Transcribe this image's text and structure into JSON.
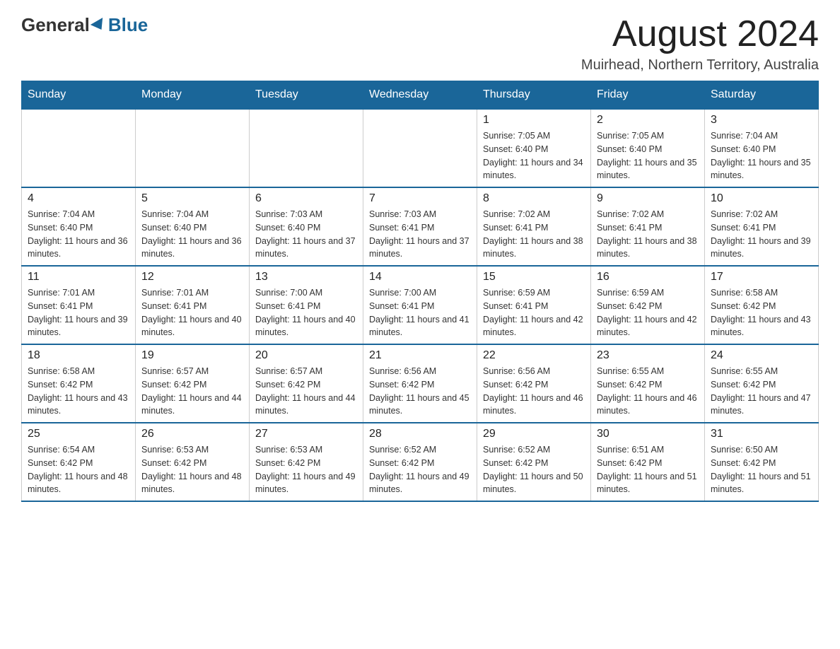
{
  "header": {
    "logo": {
      "general": "General",
      "blue": "Blue"
    },
    "title": "August 2024",
    "location": "Muirhead, Northern Territory, Australia"
  },
  "days_of_week": [
    "Sunday",
    "Monday",
    "Tuesday",
    "Wednesday",
    "Thursday",
    "Friday",
    "Saturday"
  ],
  "weeks": [
    [
      {
        "day": "",
        "info": ""
      },
      {
        "day": "",
        "info": ""
      },
      {
        "day": "",
        "info": ""
      },
      {
        "day": "",
        "info": ""
      },
      {
        "day": "1",
        "info": "Sunrise: 7:05 AM\nSunset: 6:40 PM\nDaylight: 11 hours and 34 minutes."
      },
      {
        "day": "2",
        "info": "Sunrise: 7:05 AM\nSunset: 6:40 PM\nDaylight: 11 hours and 35 minutes."
      },
      {
        "day": "3",
        "info": "Sunrise: 7:04 AM\nSunset: 6:40 PM\nDaylight: 11 hours and 35 minutes."
      }
    ],
    [
      {
        "day": "4",
        "info": "Sunrise: 7:04 AM\nSunset: 6:40 PM\nDaylight: 11 hours and 36 minutes."
      },
      {
        "day": "5",
        "info": "Sunrise: 7:04 AM\nSunset: 6:40 PM\nDaylight: 11 hours and 36 minutes."
      },
      {
        "day": "6",
        "info": "Sunrise: 7:03 AM\nSunset: 6:40 PM\nDaylight: 11 hours and 37 minutes."
      },
      {
        "day": "7",
        "info": "Sunrise: 7:03 AM\nSunset: 6:41 PM\nDaylight: 11 hours and 37 minutes."
      },
      {
        "day": "8",
        "info": "Sunrise: 7:02 AM\nSunset: 6:41 PM\nDaylight: 11 hours and 38 minutes."
      },
      {
        "day": "9",
        "info": "Sunrise: 7:02 AM\nSunset: 6:41 PM\nDaylight: 11 hours and 38 minutes."
      },
      {
        "day": "10",
        "info": "Sunrise: 7:02 AM\nSunset: 6:41 PM\nDaylight: 11 hours and 39 minutes."
      }
    ],
    [
      {
        "day": "11",
        "info": "Sunrise: 7:01 AM\nSunset: 6:41 PM\nDaylight: 11 hours and 39 minutes."
      },
      {
        "day": "12",
        "info": "Sunrise: 7:01 AM\nSunset: 6:41 PM\nDaylight: 11 hours and 40 minutes."
      },
      {
        "day": "13",
        "info": "Sunrise: 7:00 AM\nSunset: 6:41 PM\nDaylight: 11 hours and 40 minutes."
      },
      {
        "day": "14",
        "info": "Sunrise: 7:00 AM\nSunset: 6:41 PM\nDaylight: 11 hours and 41 minutes."
      },
      {
        "day": "15",
        "info": "Sunrise: 6:59 AM\nSunset: 6:41 PM\nDaylight: 11 hours and 42 minutes."
      },
      {
        "day": "16",
        "info": "Sunrise: 6:59 AM\nSunset: 6:42 PM\nDaylight: 11 hours and 42 minutes."
      },
      {
        "day": "17",
        "info": "Sunrise: 6:58 AM\nSunset: 6:42 PM\nDaylight: 11 hours and 43 minutes."
      }
    ],
    [
      {
        "day": "18",
        "info": "Sunrise: 6:58 AM\nSunset: 6:42 PM\nDaylight: 11 hours and 43 minutes."
      },
      {
        "day": "19",
        "info": "Sunrise: 6:57 AM\nSunset: 6:42 PM\nDaylight: 11 hours and 44 minutes."
      },
      {
        "day": "20",
        "info": "Sunrise: 6:57 AM\nSunset: 6:42 PM\nDaylight: 11 hours and 44 minutes."
      },
      {
        "day": "21",
        "info": "Sunrise: 6:56 AM\nSunset: 6:42 PM\nDaylight: 11 hours and 45 minutes."
      },
      {
        "day": "22",
        "info": "Sunrise: 6:56 AM\nSunset: 6:42 PM\nDaylight: 11 hours and 46 minutes."
      },
      {
        "day": "23",
        "info": "Sunrise: 6:55 AM\nSunset: 6:42 PM\nDaylight: 11 hours and 46 minutes."
      },
      {
        "day": "24",
        "info": "Sunrise: 6:55 AM\nSunset: 6:42 PM\nDaylight: 11 hours and 47 minutes."
      }
    ],
    [
      {
        "day": "25",
        "info": "Sunrise: 6:54 AM\nSunset: 6:42 PM\nDaylight: 11 hours and 48 minutes."
      },
      {
        "day": "26",
        "info": "Sunrise: 6:53 AM\nSunset: 6:42 PM\nDaylight: 11 hours and 48 minutes."
      },
      {
        "day": "27",
        "info": "Sunrise: 6:53 AM\nSunset: 6:42 PM\nDaylight: 11 hours and 49 minutes."
      },
      {
        "day": "28",
        "info": "Sunrise: 6:52 AM\nSunset: 6:42 PM\nDaylight: 11 hours and 49 minutes."
      },
      {
        "day": "29",
        "info": "Sunrise: 6:52 AM\nSunset: 6:42 PM\nDaylight: 11 hours and 50 minutes."
      },
      {
        "day": "30",
        "info": "Sunrise: 6:51 AM\nSunset: 6:42 PM\nDaylight: 11 hours and 51 minutes."
      },
      {
        "day": "31",
        "info": "Sunrise: 6:50 AM\nSunset: 6:42 PM\nDaylight: 11 hours and 51 minutes."
      }
    ]
  ]
}
